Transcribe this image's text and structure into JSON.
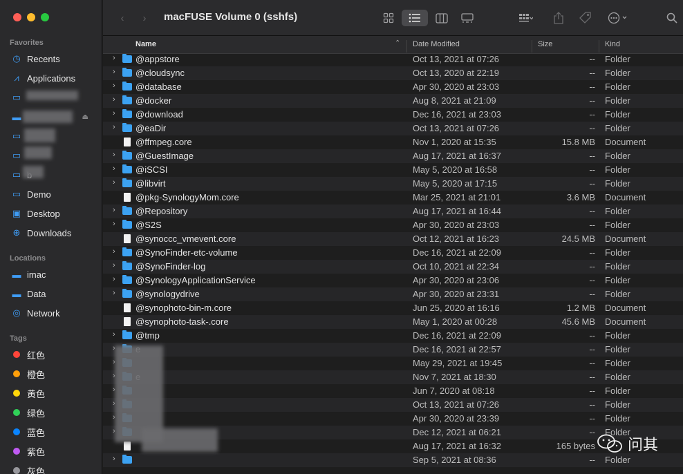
{
  "window": {
    "title": "macFUSE Volume 0 (sshfs)"
  },
  "sidebar": {
    "favorites_label": "Favorites",
    "favorites": [
      {
        "label": "Recents",
        "icon": "clock-icon"
      },
      {
        "label": "Applications",
        "icon": "apps-icon"
      },
      {
        "label": "",
        "icon": "folder-icon"
      },
      {
        "label": "",
        "icon": "drive-icon"
      },
      {
        "label": "",
        "icon": "folder-icon"
      },
      {
        "label": "",
        "icon": "folder-icon"
      },
      {
        "label": "b",
        "icon": "folder-icon"
      },
      {
        "label": "Demo",
        "icon": "folder-icon"
      },
      {
        "label": "Desktop",
        "icon": "desktop-icon"
      },
      {
        "label": "Downloads",
        "icon": "download-icon"
      }
    ],
    "locations_label": "Locations",
    "locations": [
      {
        "label": "imac",
        "icon": "drive-icon"
      },
      {
        "label": "Data",
        "icon": "drive-icon"
      },
      {
        "label": "Network",
        "icon": "globe-icon"
      }
    ],
    "tags_label": "Tags",
    "tags": [
      {
        "label": "红色",
        "color": "#ff453a"
      },
      {
        "label": "橙色",
        "color": "#ff9f0a"
      },
      {
        "label": "黄色",
        "color": "#ffd60a"
      },
      {
        "label": "绿色",
        "color": "#30d158"
      },
      {
        "label": "蓝色",
        "color": "#0a84ff"
      },
      {
        "label": "紫色",
        "color": "#bf5af2"
      },
      {
        "label": "灰色",
        "color": "#98989d"
      }
    ]
  },
  "columns": {
    "name": "Name",
    "date": "Date Modified",
    "size": "Size",
    "kind": "Kind"
  },
  "files": [
    {
      "name": "@appstore",
      "date": "Oct 13, 2021 at 07:26",
      "size": "--",
      "kind": "Folder",
      "type": "folder"
    },
    {
      "name": "@cloudsync",
      "date": "Oct 13, 2020 at 22:19",
      "size": "--",
      "kind": "Folder",
      "type": "folder"
    },
    {
      "name": "@database",
      "date": "Apr 30, 2020 at 23:03",
      "size": "--",
      "kind": "Folder",
      "type": "folder"
    },
    {
      "name": "@docker",
      "date": "Aug 8, 2021 at 21:09",
      "size": "--",
      "kind": "Folder",
      "type": "folder"
    },
    {
      "name": "@download",
      "date": "Dec 16, 2021 at 23:03",
      "size": "--",
      "kind": "Folder",
      "type": "folder"
    },
    {
      "name": "@eaDir",
      "date": "Oct 13, 2021 at 07:26",
      "size": "--",
      "kind": "Folder",
      "type": "folder"
    },
    {
      "name": "@ffmpeg.core",
      "date": "Nov 1, 2020 at 15:35",
      "size": "15.8 MB",
      "kind": "Document",
      "type": "doc"
    },
    {
      "name": "@GuestImage",
      "date": "Aug 17, 2021 at 16:37",
      "size": "--",
      "kind": "Folder",
      "type": "folder"
    },
    {
      "name": "@iSCSI",
      "date": "May 5, 2020 at 16:58",
      "size": "--",
      "kind": "Folder",
      "type": "folder"
    },
    {
      "name": "@libvirt",
      "date": "May 5, 2020 at 17:15",
      "size": "--",
      "kind": "Folder",
      "type": "folder"
    },
    {
      "name": "@pkg-SynologyMom.core",
      "date": "Mar 25, 2021 at 21:01",
      "size": "3.6 MB",
      "kind": "Document",
      "type": "doc"
    },
    {
      "name": "@Repository",
      "date": "Aug 17, 2021 at 16:44",
      "size": "--",
      "kind": "Folder",
      "type": "folder"
    },
    {
      "name": "@S2S",
      "date": "Apr 30, 2020 at 23:03",
      "size": "--",
      "kind": "Folder",
      "type": "folder"
    },
    {
      "name": "@synoccc_vmevent.core",
      "date": "Oct 12, 2021 at 16:23",
      "size": "24.5 MB",
      "kind": "Document",
      "type": "doc"
    },
    {
      "name": "@SynoFinder-etc-volume",
      "date": "Dec 16, 2021 at 22:09",
      "size": "--",
      "kind": "Folder",
      "type": "folder"
    },
    {
      "name": "@SynoFinder-log",
      "date": "Oct 10, 2021 at 22:34",
      "size": "--",
      "kind": "Folder",
      "type": "folder"
    },
    {
      "name": "@SynologyApplicationService",
      "date": "Apr 30, 2020 at 23:06",
      "size": "--",
      "kind": "Folder",
      "type": "folder"
    },
    {
      "name": "@synologydrive",
      "date": "Apr 30, 2020 at 23:31",
      "size": "--",
      "kind": "Folder",
      "type": "folder"
    },
    {
      "name": "@synophoto-bin-m.core",
      "date": "Jun 25, 2020 at 16:16",
      "size": "1.2 MB",
      "kind": "Document",
      "type": "doc"
    },
    {
      "name": "@synophoto-task-.core",
      "date": "May 1, 2020 at 00:28",
      "size": "45.6 MB",
      "kind": "Document",
      "type": "doc"
    },
    {
      "name": "@tmp",
      "date": "Dec 16, 2021 at 22:09",
      "size": "--",
      "kind": "Folder",
      "type": "folder"
    },
    {
      "name": "e",
      "date": "Dec 16, 2021 at 22:57",
      "size": "--",
      "kind": "Folder",
      "type": "folder"
    },
    {
      "name": "",
      "date": "May 29, 2021 at 19:45",
      "size": "--",
      "kind": "Folder",
      "type": "folder"
    },
    {
      "name": "e",
      "date": "Nov 7, 2021 at 18:30",
      "size": "--",
      "kind": "Folder",
      "type": "folder"
    },
    {
      "name": "",
      "date": "Jun 7, 2020 at 08:18",
      "size": "--",
      "kind": "Folder",
      "type": "folder"
    },
    {
      "name": "",
      "date": "Oct 13, 2021 at 07:26",
      "size": "--",
      "kind": "Folder",
      "type": "folder"
    },
    {
      "name": "",
      "date": "Apr 30, 2020 at 23:39",
      "size": "--",
      "kind": "Folder",
      "type": "folder"
    },
    {
      "name": "",
      "date": "Dec 12, 2021 at 06:21",
      "size": "--",
      "kind": "Folder",
      "type": "folder"
    },
    {
      "name": "",
      "date": "Aug 17, 2021 at 16:32",
      "size": "165 bytes",
      "kind": "",
      "type": "doc"
    },
    {
      "name": "",
      "date": "Sep 5, 2021 at 08:36",
      "size": "--",
      "kind": "Folder",
      "type": "folder"
    }
  ],
  "watermark": {
    "text": "问其"
  }
}
